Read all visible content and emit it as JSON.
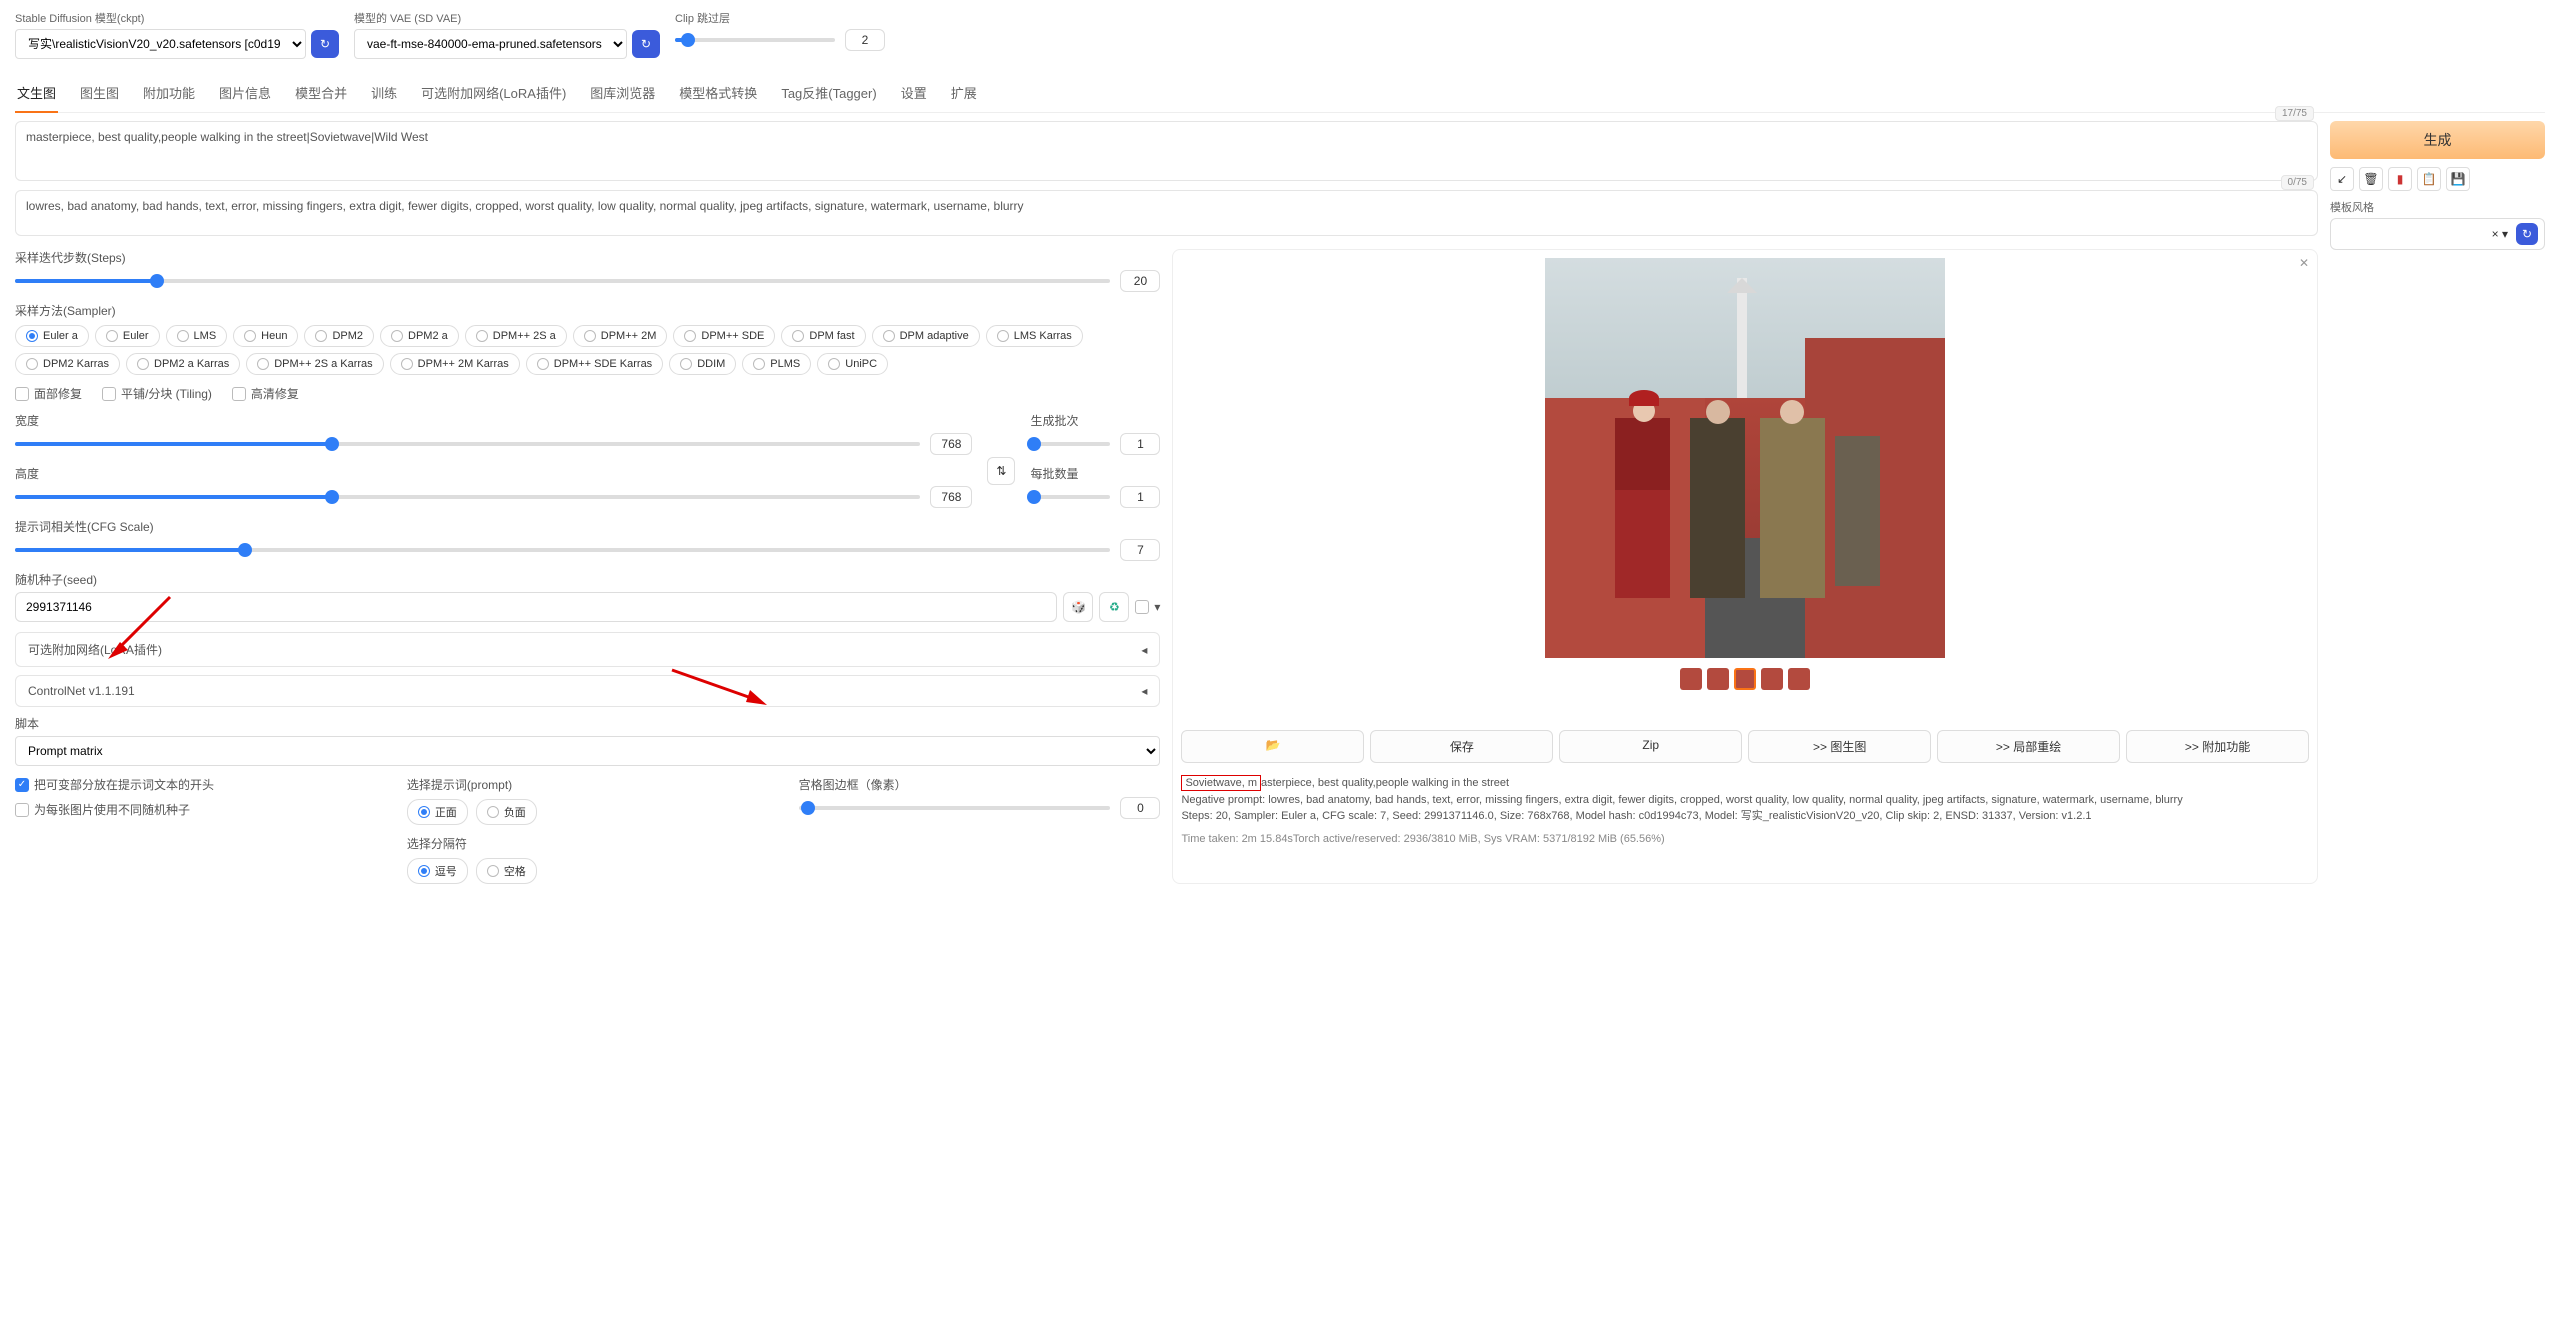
{
  "top": {
    "model_label": "Stable Diffusion 模型(ckpt)",
    "model_value": "写实\\realisticVisionV20_v20.safetensors [c0d19",
    "vae_label": "模型的 VAE (SD VAE)",
    "vae_value": "vae-ft-mse-840000-ema-pruned.safetensors",
    "clip_label": "Clip 跳过层",
    "clip_value": "2"
  },
  "tabs": [
    "文生图",
    "图生图",
    "附加功能",
    "图片信息",
    "模型合并",
    "训练",
    "可选附加网络(LoRA插件)",
    "图库浏览器",
    "模型格式转换",
    "Tag反推(Tagger)",
    "设置",
    "扩展"
  ],
  "prompt": {
    "positive": "masterpiece, best quality,people walking in the street|Sovietwave|Wild West",
    "positive_count": "17/75",
    "negative": "lowres, bad anatomy, bad hands, text, error, missing fingers, extra digit, fewer digits, cropped, worst quality, low quality, normal quality, jpeg artifacts, signature, watermark, username, blurry",
    "negative_count": "0/75"
  },
  "generate": "生成",
  "style_label": "模板风格",
  "steps": {
    "label": "采样迭代步数(Steps)",
    "value": "20"
  },
  "sampler": {
    "label": "采样方法(Sampler)",
    "options": [
      "Euler a",
      "Euler",
      "LMS",
      "Heun",
      "DPM2",
      "DPM2 a",
      "DPM++ 2S a",
      "DPM++ 2M",
      "DPM++ SDE",
      "DPM fast",
      "DPM adaptive",
      "LMS Karras",
      "DPM2 Karras",
      "DPM2 a Karras",
      "DPM++ 2S a Karras",
      "DPM++ 2M Karras",
      "DPM++ SDE Karras",
      "DDIM",
      "PLMS",
      "UniPC"
    ],
    "selected": "Euler a"
  },
  "checks": {
    "face": "面部修复",
    "tiling": "平铺/分块 (Tiling)",
    "hires": "高清修复"
  },
  "width": {
    "label": "宽度",
    "value": "768"
  },
  "height": {
    "label": "高度",
    "value": "768"
  },
  "batch_count": {
    "label": "生成批次",
    "value": "1"
  },
  "batch_size": {
    "label": "每批数量",
    "value": "1"
  },
  "cfg": {
    "label": "提示词相关性(CFG Scale)",
    "value": "7"
  },
  "seed": {
    "label": "随机种子(seed)",
    "value": "2991371146"
  },
  "accordion1": "可选附加网络(LoRA插件)",
  "accordion2": "ControlNet v1.1.191",
  "script": {
    "label": "脚本",
    "value": "Prompt matrix",
    "check1": "把可变部分放在提示词文本的开头",
    "check2": "为每张图片使用不同随机种子",
    "prompt_select_label": "选择提示词(prompt)",
    "prompt_opts": [
      "正面",
      "负面"
    ],
    "sep_label": "选择分隔符",
    "sep_opts": [
      "逗号",
      "空格"
    ],
    "margin_label": "宫格图边框（像素）",
    "margin_value": "0"
  },
  "output": {
    "buttons": {
      "folder": "📂",
      "save": "保存",
      "zip": "Zip",
      "img2img": ">> 图生图",
      "inpaint": ">> 局部重绘",
      "extras": ">> 附加功能"
    },
    "line1_hl": "Sovietwave, m",
    "line1_rest": "asterpiece, best quality,people walking in the street",
    "line2": "Negative prompt: lowres, bad anatomy, bad hands, text, error, missing fingers, extra digit, fewer digits, cropped, worst quality, low quality, normal quality, jpeg artifacts, signature, watermark, username, blurry",
    "line3": "Steps: 20, Sampler: Euler a, CFG scale: 7, Seed: 2991371146.0, Size: 768x768, Model hash: c0d1994c73, Model: 写实_realisticVisionV20_v20, Clip skip: 2, ENSD: 31337, Version: v1.2.1",
    "time": "Time taken: 2m 15.84sTorch active/reserved: 2936/3810 MiB, Sys VRAM: 5371/8192 MiB (65.56%)"
  }
}
